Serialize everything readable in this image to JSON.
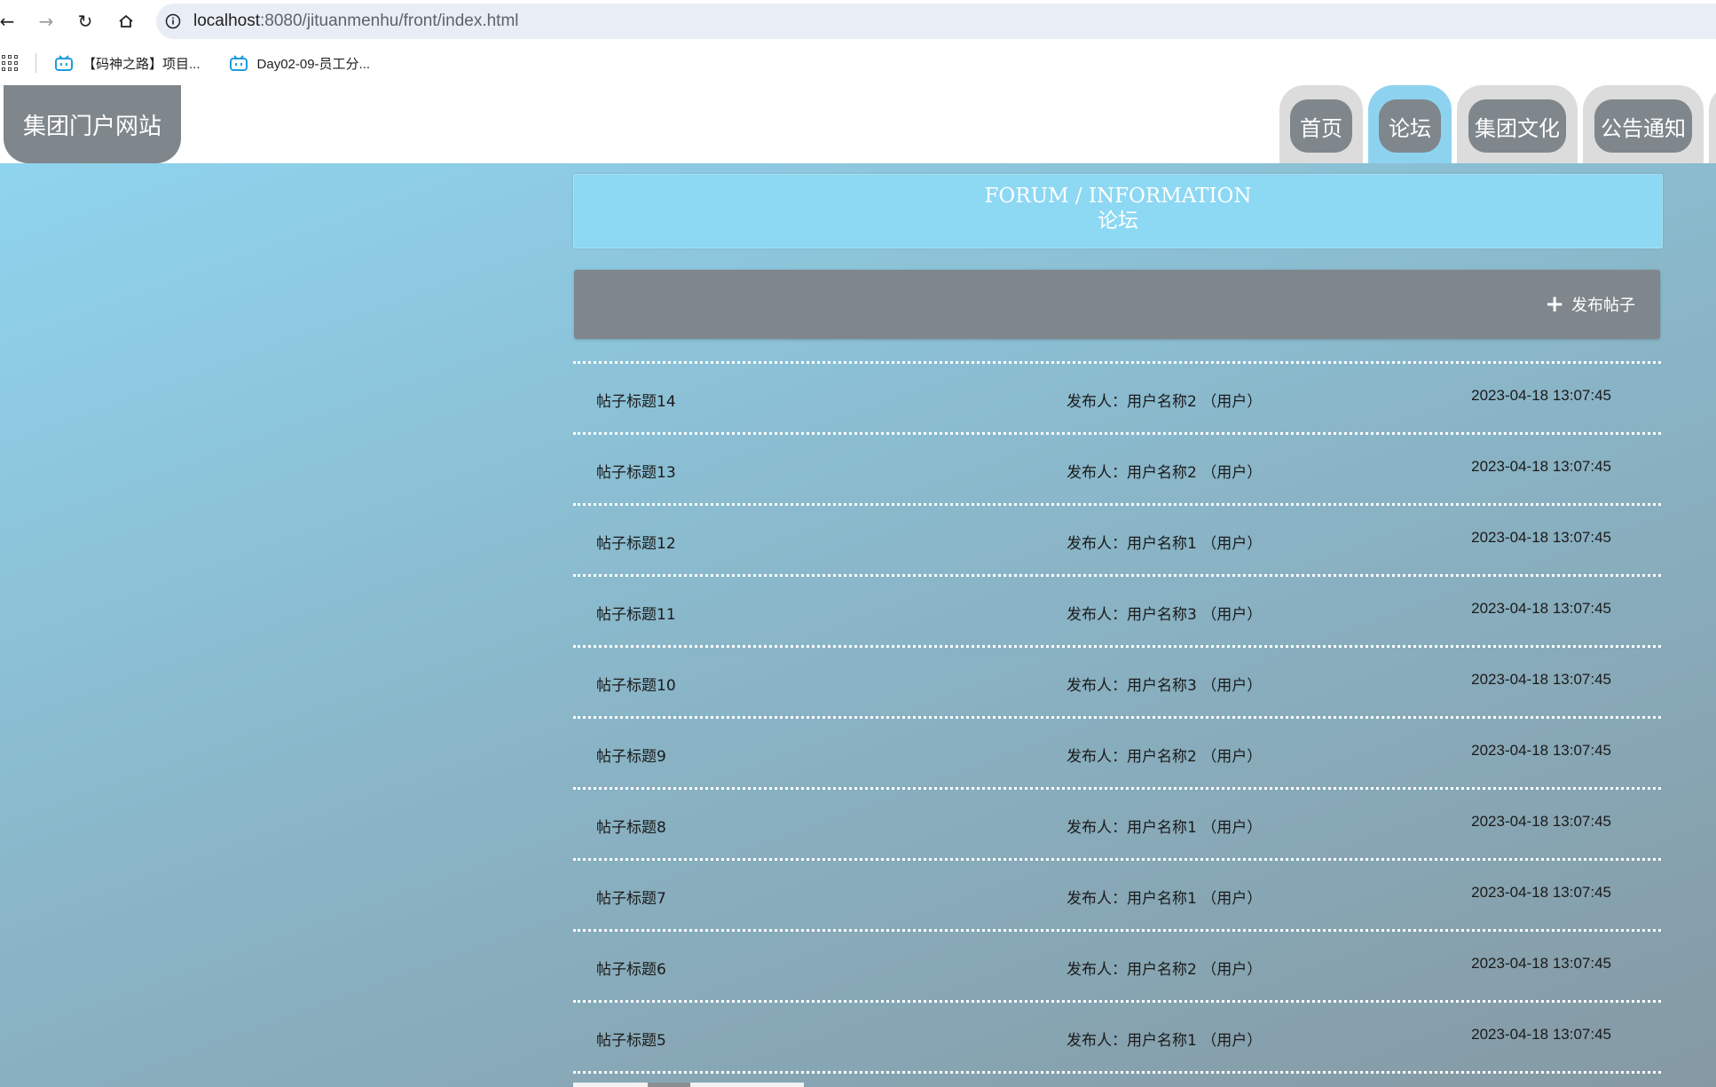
{
  "browser": {
    "url_host": "localhost",
    "url_path": ":8080/jituanmenhu/front/index.html",
    "bookmarks": [
      {
        "label": "【码神之路】项目..."
      },
      {
        "label": "Day02-09-员工分..."
      }
    ]
  },
  "site": {
    "logo_text": "集团门户网站",
    "nav": [
      {
        "label": "首页",
        "active": false
      },
      {
        "label": "论坛",
        "active": true
      },
      {
        "label": "集团文化",
        "active": false
      },
      {
        "label": "公告通知",
        "active": false
      }
    ]
  },
  "forum": {
    "banner_en": "FORUM / INFORMATION",
    "banner_cn": "论坛",
    "publish_label": "发布帖子",
    "posts": [
      {
        "title": "帖子标题14",
        "author": "发布人：用户名称2 （用户）",
        "time": "2023-04-18 13:07:45"
      },
      {
        "title": "帖子标题13",
        "author": "发布人：用户名称2 （用户）",
        "time": "2023-04-18 13:07:45"
      },
      {
        "title": "帖子标题12",
        "author": "发布人：用户名称1 （用户）",
        "time": "2023-04-18 13:07:45"
      },
      {
        "title": "帖子标题11",
        "author": "发布人：用户名称3 （用户）",
        "time": "2023-04-18 13:07:45"
      },
      {
        "title": "帖子标题10",
        "author": "发布人：用户名称3 （用户）",
        "time": "2023-04-18 13:07:45"
      },
      {
        "title": "帖子标题9",
        "author": "发布人：用户名称2 （用户）",
        "time": "2023-04-18 13:07:45"
      },
      {
        "title": "帖子标题8",
        "author": "发布人：用户名称1 （用户）",
        "time": "2023-04-18 13:07:45"
      },
      {
        "title": "帖子标题7",
        "author": "发布人：用户名称1 （用户）",
        "time": "2023-04-18 13:07:45"
      },
      {
        "title": "帖子标题6",
        "author": "发布人：用户名称2 （用户）",
        "time": "2023-04-18 13:07:45"
      },
      {
        "title": "帖子标题5",
        "author": "发布人：用户名称1 （用户）",
        "time": "2023-04-18 13:07:45"
      }
    ]
  },
  "colors": {
    "logo_bg": "#7f878c",
    "tab_active": "#8dd3ef",
    "banner_bg": "#8dd8f3",
    "action_bar_bg": "#7f878c"
  }
}
